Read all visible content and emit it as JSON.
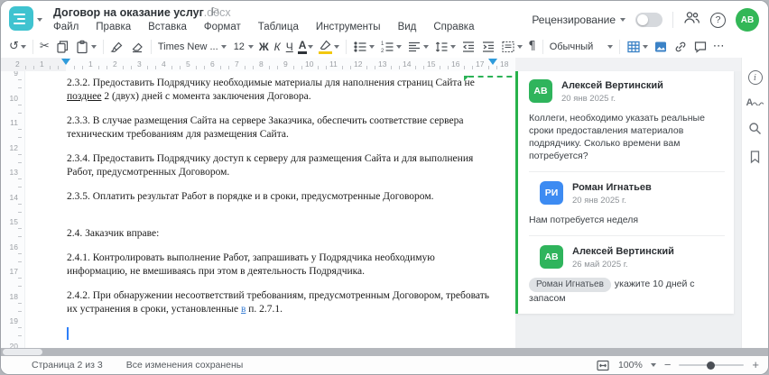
{
  "window": {
    "title": "Договор на оказание услуг",
    "title_ext": ".docx"
  },
  "menu": {
    "items": [
      "Файл",
      "Правка",
      "Вставка",
      "Формат",
      "Таблица",
      "Инструменты",
      "Вид",
      "Справка"
    ]
  },
  "topbar": {
    "review_mode_label": "Рецензирование",
    "avatar_initials": "АВ"
  },
  "toolbar": {
    "font_name": "Times New ...",
    "font_size": "12",
    "bold": "Ж",
    "italic": "К",
    "underline": "Ч",
    "font_color": "А",
    "paragraph_style": "Обычный",
    "more": "⋯",
    "pilcrow": "¶"
  },
  "ruler": {
    "left_numbers": [
      "2",
      "1"
    ],
    "main_numbers": [
      "1",
      "2",
      "3",
      "4",
      "5",
      "6",
      "7",
      "8",
      "9",
      "10",
      "11",
      "12",
      "13",
      "14",
      "15",
      "16",
      "17",
      "18"
    ],
    "vertical_numbers": [
      "9",
      "10",
      "11",
      "12",
      "13",
      "14",
      "15",
      "16",
      "17",
      "18",
      "19",
      "20"
    ]
  },
  "document": {
    "p1a": "2.3.2. Предоставить Подрядчику необходимые материалы для наполнения страниц Сайта не ",
    "p1b": "позднее",
    "p1c": " 2 (двух) дней с момента заключения Договора.",
    "p2": "2.3.3. В случае размещения Сайта на сервере Заказчика, обеспечить соответствие сервера техническим требованиям для размещения Сайта.",
    "p3": "2.3.4. Предоставить Подрядчику доступ к серверу для размещения Сайта и для выполнения Работ, предусмотренных Договором.",
    "p4": "2.3.5. Оплатить результат Работ в порядке и в сроки, предусмотренные Договором.",
    "p5": "2.4. Заказчик вправе:",
    "p6": "2.4.1. Контролировать выполнение Работ, запрашивать у Подрядчика необходимую информацию, не вмешиваясь при этом в деятельность Подрядчика.",
    "p7a": "2.4.2. При обнаружении несоответствий требованиям, предусмотренным Договором, требовать их устранения в сроки, установленные ",
    "p7b": "в",
    "p7c": " п. 2.7.1."
  },
  "comments": {
    "c1": {
      "initials": "АВ",
      "author": "Алексей Вертинский",
      "date": "20 янв 2025 г.",
      "text": "Коллеги, необходимо указать реальные сроки предоставления материалов подрядчику. Сколько времени вам потребуется?"
    },
    "c2": {
      "initials": "РИ",
      "author": "Роман Игнатьев",
      "date": "20 янв 2025 г.",
      "text": "Нам потребуется неделя"
    },
    "c3": {
      "initials": "АВ",
      "author": "Алексей Вертинский",
      "date": "26 май 2025 г.",
      "mention": "Роман Игнатьев",
      "text": "укажите 10 дней с запасом"
    }
  },
  "statusbar": {
    "page_indicator": "Страница 2 из 3",
    "save_status": "Все изменения сохранены",
    "zoom_level": "100%"
  },
  "colors": {
    "brand_teal": "#3fc3d0",
    "avatar_green": "#2fb45c",
    "avatar_blue": "#3d8bf2",
    "comment_anchor_green": "#27b24a",
    "selection_blue": "#2d7ff9"
  }
}
